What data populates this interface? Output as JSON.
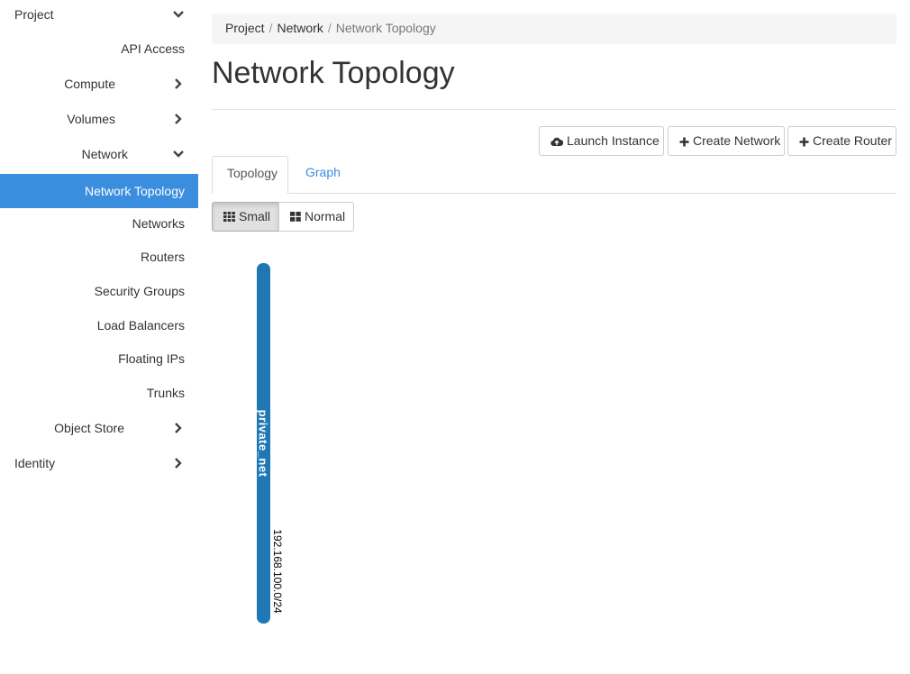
{
  "sidebar": {
    "project": "Project",
    "api_access": "API Access",
    "compute": "Compute",
    "volumes": "Volumes",
    "network": "Network",
    "network_items": [
      "Network Topology",
      "Networks",
      "Routers",
      "Security Groups",
      "Load Balancers",
      "Floating IPs",
      "Trunks"
    ],
    "object_store": "Object Store",
    "identity": "Identity",
    "active_color": "#3b8ede"
  },
  "breadcrumb": {
    "items": [
      "Project",
      "Network"
    ],
    "separator": "/",
    "current": "Network Topology"
  },
  "page": {
    "title": "Network Topology"
  },
  "actions": {
    "launch_instance": "Launch Instance",
    "create_network": "Create Network",
    "create_router": "Create Router"
  },
  "tabs": [
    "Topology",
    "Graph"
  ],
  "size_toggle": {
    "small": "Small",
    "normal": "Normal",
    "selected": "Small"
  },
  "topology": {
    "network": {
      "name": "private_net",
      "cidr": "192.168.100.0/24",
      "color": "#1f77b4"
    }
  }
}
